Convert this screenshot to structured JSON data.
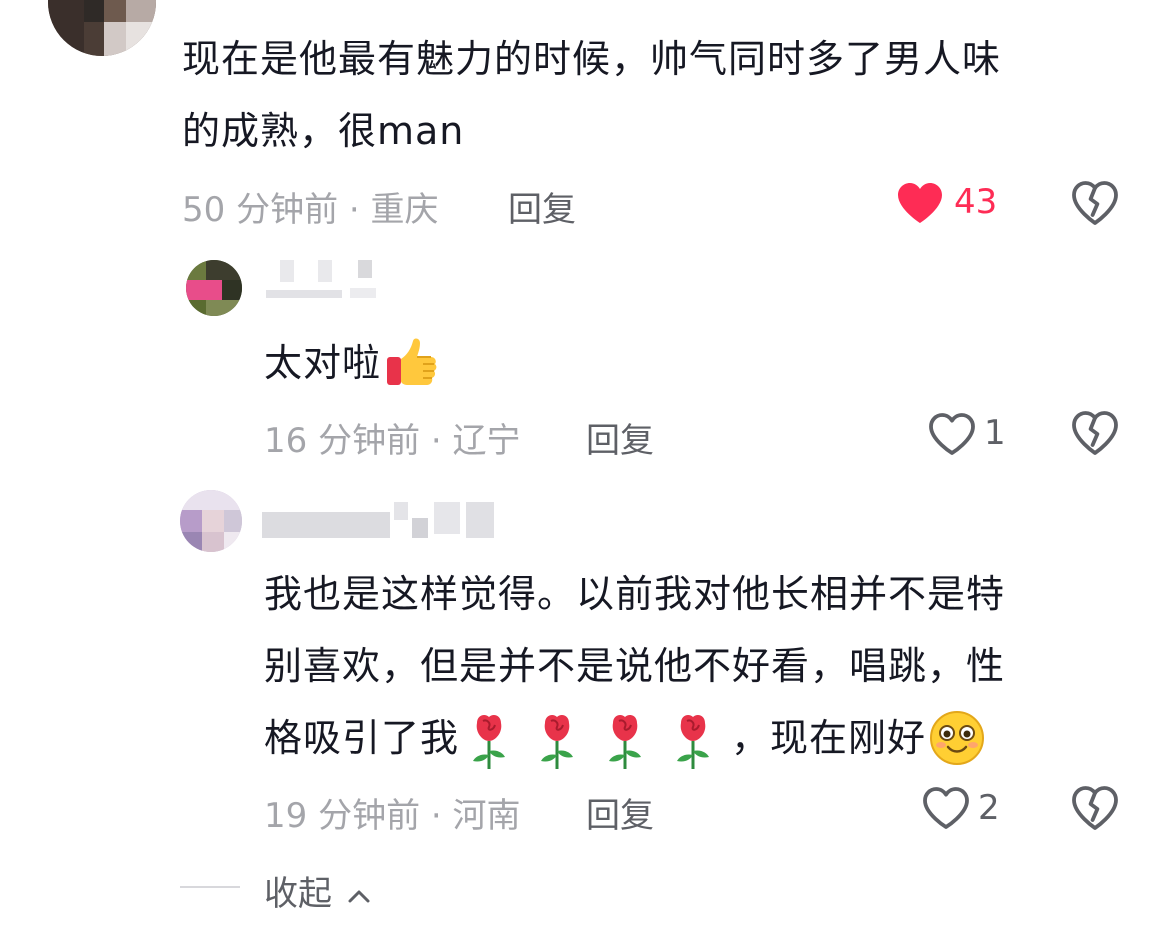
{
  "comment": {
    "author": "",
    "text_line1": "现在是他最有魅力的时候，帅气同时多了男人味",
    "text_line2": "的成熟，很man",
    "time": "50 分钟前",
    "location": "重庆",
    "reply_label": "回复",
    "likes": "43",
    "liked": true
  },
  "replies": [
    {
      "text_line1": "太对啦",
      "emoji": "thumbs-up",
      "time": "16 分钟前",
      "location": "辽宁",
      "reply_label": "回复",
      "likes": "1"
    },
    {
      "text_line1": "我也是这样觉得。以前我对他长相并不是特",
      "text_line2": "别喜欢，但是并不是说他不好看，唱跳，性",
      "text_line3a": "格吸引了我",
      "text_line3b": "，现在刚好",
      "emoji_roses": 4,
      "emoji_end": "smiling-face",
      "time": "19 分钟前",
      "location": "河南",
      "reply_label": "回复",
      "likes": "2"
    }
  ],
  "collapse_label": "收起",
  "separator": " · ",
  "colors": {
    "accent": "#fe2c55",
    "meta": "#a4a5aa",
    "secondary": "#5e6066",
    "text": "#161823"
  }
}
